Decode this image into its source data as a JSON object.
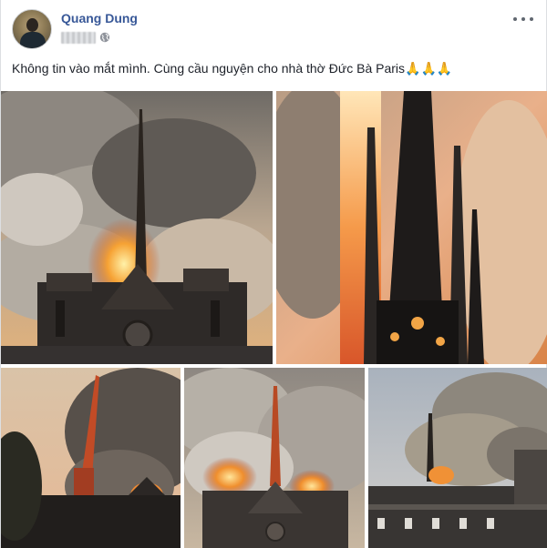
{
  "post": {
    "author": "Quang Dung",
    "privacy_icon": "globe-icon",
    "more_icon": "more-options-icon",
    "text": "Không tin vào mắt mình. Cùng cầu nguyện cho nhà thờ Đức Bà Paris",
    "emoji": "🙏🙏🙏",
    "photos": [
      {
        "name": "cathedral-fire-smoke"
      },
      {
        "name": "burning-spire-closeup"
      },
      {
        "name": "falling-spire-silhouette"
      },
      {
        "name": "spire-flames-front"
      },
      {
        "name": "smoke-over-rooftops"
      }
    ]
  },
  "colors": {
    "author_link": "#385898",
    "text": "#1d2129",
    "fire": "#f39b2b",
    "smoke": "#9a9690"
  }
}
